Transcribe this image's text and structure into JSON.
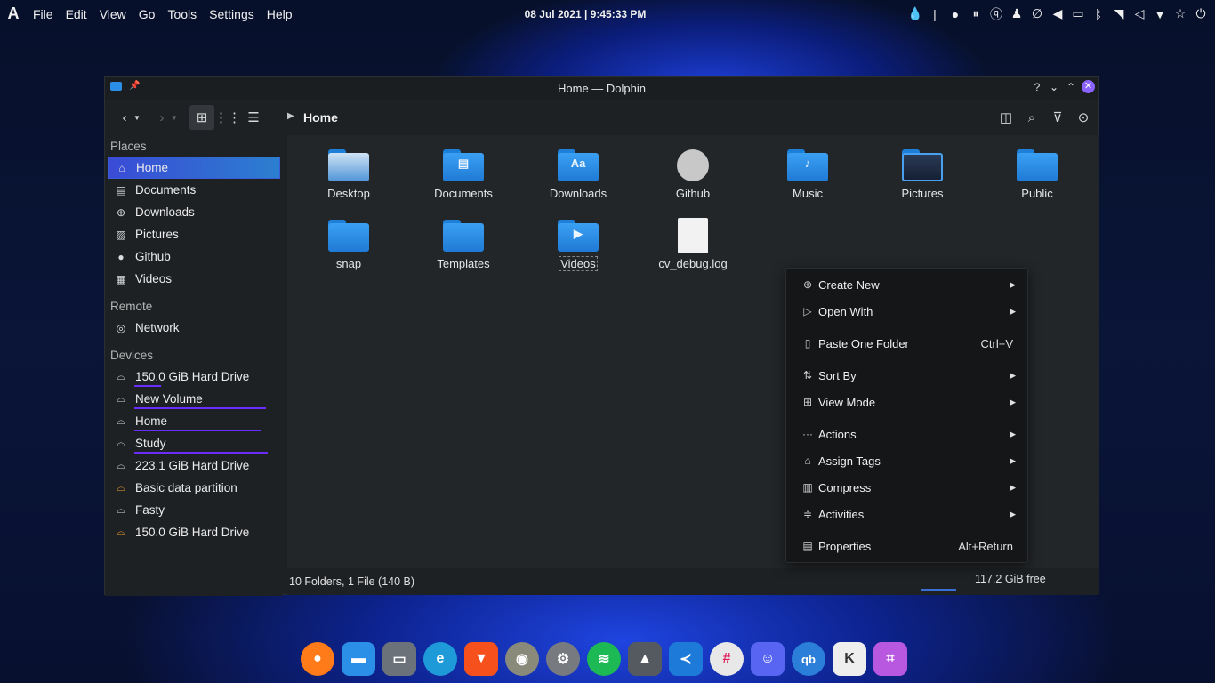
{
  "topbar": {
    "logo": "A",
    "menu": [
      "File",
      "Edit",
      "View",
      "Go",
      "Tools",
      "Settings",
      "Help"
    ],
    "clock": "08 Jul 2021 | 9:45:33 PM",
    "tray_icons": [
      "droplet-icon",
      "separator-icon",
      "record-icon",
      "pause-icon",
      "qbittorrent-icon",
      "bag-icon",
      "clip-icon",
      "volume-icon",
      "battery-icon",
      "bluetooth-icon",
      "wifi-icon",
      "volume-icon-2",
      "dropdown-icon",
      "star-icon",
      "power-icon"
    ]
  },
  "window": {
    "title": "Home — Dolphin",
    "help_label": "?",
    "breadcrumb": "Home"
  },
  "sidebar": {
    "places_label": "Places",
    "places": [
      {
        "label": "Home",
        "icon": "home-icon",
        "selected": true
      },
      {
        "label": "Documents",
        "icon": "document-icon"
      },
      {
        "label": "Downloads",
        "icon": "download-icon"
      },
      {
        "label": "Pictures",
        "icon": "image-icon"
      },
      {
        "label": "Github",
        "icon": "github-icon"
      },
      {
        "label": "Videos",
        "icon": "video-icon"
      }
    ],
    "remote_label": "Remote",
    "remote": [
      {
        "label": "Network",
        "icon": "network-icon"
      }
    ],
    "devices_label": "Devices",
    "devices": [
      {
        "label": "150.0 GiB Hard Drive",
        "usage": 0.18
      },
      {
        "label": "New Volume",
        "usage": 0.85
      },
      {
        "label": "Home",
        "usage": 0.8
      },
      {
        "label": "Study",
        "usage": 0.85
      },
      {
        "label": "223.1 GiB Hard Drive",
        "usage": 0
      },
      {
        "label": "Basic data partition",
        "usage": 0
      },
      {
        "label": "Fasty",
        "usage": 0
      },
      {
        "label": "150.0 GiB Hard Drive",
        "usage": 0
      }
    ]
  },
  "files": [
    {
      "label": "Desktop",
      "kind": "folder",
      "glyph": ""
    },
    {
      "label": "Documents",
      "kind": "folder",
      "glyph": "▤"
    },
    {
      "label": "Downloads",
      "kind": "folder",
      "glyph": "Aa"
    },
    {
      "label": "Github",
      "kind": "github",
      "glyph": ""
    },
    {
      "label": "Music",
      "kind": "folder",
      "glyph": "♪"
    },
    {
      "label": "Pictures",
      "kind": "folder",
      "glyph": "▣"
    },
    {
      "label": "Public",
      "kind": "folder",
      "glyph": ""
    },
    {
      "label": "snap",
      "kind": "folder",
      "glyph": ""
    },
    {
      "label": "Templates",
      "kind": "folder",
      "glyph": ""
    },
    {
      "label": "Videos",
      "kind": "folder",
      "glyph": "▶"
    },
    {
      "label": "cv_debug.log",
      "kind": "file",
      "glyph": ""
    }
  ],
  "status": {
    "summary": "10 Folders, 1 File (140 B)",
    "free": "117.2 GiB free"
  },
  "context_menu": [
    {
      "label": "Create New",
      "icon": "create-new-icon",
      "glyph": "⊕",
      "submenu": true
    },
    {
      "label": "Open With",
      "icon": "open-with-icon",
      "glyph": "▷",
      "submenu": true
    },
    {
      "label": "Paste One Folder",
      "icon": "paste-icon",
      "glyph": "📋",
      "shortcut": "Ctrl+V"
    },
    {
      "label": "Sort By",
      "icon": "sort-icon",
      "glyph": "⇅",
      "submenu": true
    },
    {
      "label": "View Mode",
      "icon": "view-mode-icon",
      "glyph": "⊞",
      "submenu": true
    },
    {
      "label": "Actions",
      "icon": "actions-icon",
      "glyph": "···",
      "submenu": true
    },
    {
      "label": "Assign Tags",
      "icon": "tag-icon",
      "glyph": "⌂",
      "submenu": true
    },
    {
      "label": "Compress",
      "icon": "compress-icon",
      "glyph": "▥",
      "submenu": true
    },
    {
      "label": "Activities",
      "icon": "activities-icon",
      "glyph": "≑",
      "submenu": true
    },
    {
      "label": "Properties",
      "icon": "properties-icon",
      "glyph": "▤",
      "shortcut": "Alt+Return"
    }
  ],
  "dock": [
    {
      "name": "firefox",
      "color": "#ff7a18",
      "glyph": "●"
    },
    {
      "name": "files",
      "color": "#2b8fe8",
      "glyph": "▬"
    },
    {
      "name": "terminal",
      "color": "#6c727a",
      "glyph": "▭"
    },
    {
      "name": "edge-dev",
      "color": "#1e9ad8",
      "glyph": "e"
    },
    {
      "name": "brave",
      "color": "#f6511d",
      "glyph": "▼"
    },
    {
      "name": "audio-player",
      "color": "#8a8a7a",
      "glyph": "◉"
    },
    {
      "name": "settings",
      "color": "#777b80",
      "glyph": "⚙"
    },
    {
      "name": "spotify",
      "color": "#1db954",
      "glyph": "≋"
    },
    {
      "name": "inkscape",
      "color": "#555a60",
      "glyph": "▲"
    },
    {
      "name": "vscode",
      "color": "#1e7ad8",
      "glyph": "≺"
    },
    {
      "name": "slack",
      "color": "#e8e8e8",
      "glyph": "#"
    },
    {
      "name": "discord",
      "color": "#5865f2",
      "glyph": "☺"
    },
    {
      "name": "qbittorrent",
      "color": "#2b7fd8",
      "glyph": "qb"
    },
    {
      "name": "kvantum",
      "color": "#eeeeee",
      "glyph": "K"
    },
    {
      "name": "crop-tool",
      "color": "#b857e0",
      "glyph": "⌗"
    }
  ]
}
